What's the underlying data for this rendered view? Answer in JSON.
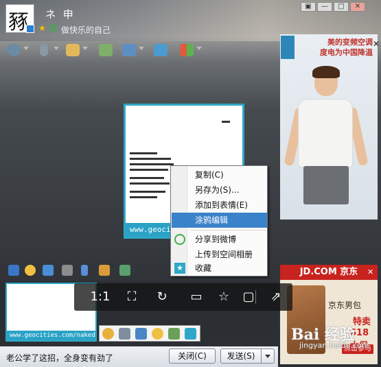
{
  "header": {
    "avatar_glyph": "豩",
    "nickname": "ネ 申",
    "signature": "做快乐的自己"
  },
  "window_controls": [
    "▣",
    "—",
    "□",
    "✕"
  ],
  "toolbar": {
    "icons": [
      "webcam-icon",
      "microphone-icon",
      "folder-icon",
      "add-app-icon",
      "screen-share-icon",
      "remote-desktop-icon",
      "apps-grid-icon"
    ]
  },
  "ads": {
    "top": {
      "text_line1": "美的变频空调",
      "text_line2": "度电为中国降温",
      "close": "✕"
    },
    "bottom": {
      "brand": "JD.COM 京东",
      "line1": "京东男包",
      "line2": "特卖",
      "line3": "618大促",
      "button": "点击参与",
      "close": "✕"
    },
    "watermark": "Bai 经验",
    "watermark_sub": "jingyan.baidu.com"
  },
  "preview": {
    "footer": "www.geociti"
  },
  "context_menu": {
    "items": [
      {
        "label": "复制(C)",
        "icon": "",
        "highlighted": false
      },
      {
        "label": "另存为(S)...",
        "icon": "",
        "highlighted": false
      },
      {
        "label": "添加到表情(E)",
        "icon": "",
        "highlighted": false
      },
      {
        "label": "涂鸦编辑",
        "icon": "",
        "highlighted": true
      },
      {
        "label": "分享到微博",
        "icon": "weibo-share-icon",
        "highlighted": false
      },
      {
        "label": "上传到空间相册",
        "icon": "",
        "highlighted": false
      },
      {
        "label": "收藏",
        "icon": "favorite-star-icon",
        "highlighted": false
      }
    ]
  },
  "viewer_toolbar": {
    "ratio_label": "1:1",
    "buttons": [
      "fit-screen-icon",
      "rotate-icon",
      "save-icon",
      "favorite-icon",
      "screenshot-icon",
      "share-icon"
    ]
  },
  "thumbnail": {
    "footer": "www.geocities.com/naked"
  },
  "status": {
    "text": "老公学了这招，全身变有劲了"
  },
  "buttons": {
    "close": "关闭(C)",
    "send": "发送(S)"
  },
  "colors": {
    "accent": "#2fa7c9",
    "menu_highlight": "#3a82c9",
    "ad_red": "#c8231f"
  }
}
